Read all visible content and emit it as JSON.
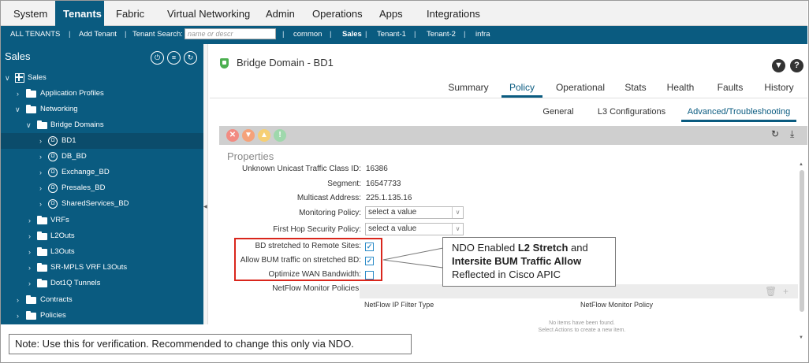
{
  "top_nav": {
    "tabs": [
      {
        "label": "System",
        "active": false
      },
      {
        "label": "Tenants",
        "active": true
      },
      {
        "label": "Fabric",
        "active": false
      },
      {
        "label": "Virtual Networking",
        "active": false
      },
      {
        "label": "Admin",
        "active": false
      },
      {
        "label": "Operations",
        "active": false
      },
      {
        "label": "Apps",
        "active": false
      },
      {
        "label": "Integrations",
        "active": false
      }
    ]
  },
  "sub_nav": {
    "all_tenants": "ALL TENANTS",
    "sep": "|",
    "add_tenant": "Add Tenant",
    "tenant_search_label": "Tenant Search:",
    "search_placeholder": "name or descr",
    "tenants": [
      "common",
      "Sales",
      "Tenant-1",
      "Tenant-2",
      "infra"
    ],
    "active_tenant": "Sales"
  },
  "sidebar": {
    "title": "Sales",
    "header_icons": [
      "quick-start-icon",
      "list-icon",
      "refresh-icon"
    ],
    "tree": [
      {
        "label": "Sales",
        "level": 0,
        "icon": "tenant-icon",
        "expanded": true
      },
      {
        "label": "Application Profiles",
        "level": 1,
        "icon": "folder-icon",
        "expanded": false
      },
      {
        "label": "Networking",
        "level": 1,
        "icon": "folder-icon",
        "expanded": true
      },
      {
        "label": "Bridge Domains",
        "level": 2,
        "icon": "folder-icon",
        "expanded": true
      },
      {
        "label": "BD1",
        "level": 3,
        "icon": "bridge-domain-icon",
        "expanded": false,
        "selected": true
      },
      {
        "label": "DB_BD",
        "level": 3,
        "icon": "bridge-domain-icon",
        "expanded": false
      },
      {
        "label": "Exchange_BD",
        "level": 3,
        "icon": "bridge-domain-icon",
        "expanded": false
      },
      {
        "label": "Presales_BD",
        "level": 3,
        "icon": "bridge-domain-icon",
        "expanded": false
      },
      {
        "label": "SharedServices_BD",
        "level": 3,
        "icon": "bridge-domain-icon",
        "expanded": false
      },
      {
        "label": "VRFs",
        "level": 2,
        "icon": "folder-icon",
        "expanded": false
      },
      {
        "label": "L2Outs",
        "level": 2,
        "icon": "folder-icon",
        "expanded": false
      },
      {
        "label": "L3Outs",
        "level": 2,
        "icon": "folder-icon",
        "expanded": false
      },
      {
        "label": "SR-MPLS VRF L3Outs",
        "level": 2,
        "icon": "folder-icon",
        "expanded": false
      },
      {
        "label": "Dot1Q Tunnels",
        "level": 2,
        "icon": "folder-icon",
        "expanded": false
      },
      {
        "label": "Contracts",
        "level": 1,
        "icon": "folder-icon",
        "expanded": false
      },
      {
        "label": "Policies",
        "level": 1,
        "icon": "folder-icon",
        "expanded": false
      }
    ]
  },
  "main": {
    "title": "Bridge Domain - BD1",
    "tabs": [
      {
        "label": "Summary",
        "active": false
      },
      {
        "label": "Policy",
        "active": true
      },
      {
        "label": "Operational",
        "active": false
      },
      {
        "label": "Stats",
        "active": false
      },
      {
        "label": "Health",
        "active": false
      },
      {
        "label": "Faults",
        "active": false
      },
      {
        "label": "History",
        "active": false
      }
    ],
    "subtabs": [
      {
        "label": "General",
        "active": false
      },
      {
        "label": "L3 Configurations",
        "active": false
      },
      {
        "label": "Advanced/Troubleshooting",
        "active": true
      }
    ],
    "toolbar_icons": [
      "critical-fault-icon",
      "major-fault-icon",
      "minor-fault-icon",
      "warning-fault-icon"
    ],
    "section_title": "Properties",
    "properties": {
      "unknown_unicast_label": "Unknown Unicast Traffic Class ID:",
      "unknown_unicast_value": "16386",
      "segment_label": "Segment:",
      "segment_value": "16547733",
      "multicast_label": "Multicast Address:",
      "multicast_value": "225.1.135.16",
      "monitoring_policy_label": "Monitoring Policy:",
      "monitoring_policy_value": "select a value",
      "first_hop_label": "First Hop Security Policy:",
      "first_hop_value": "select a value",
      "bd_stretched_label": "BD stretched to Remote Sites:",
      "bd_stretched_checked": true,
      "allow_bum_label": "Allow BUM traffic on stretched BD:",
      "allow_bum_checked": true,
      "optimize_wan_label": "Optimize WAN Bandwidth:",
      "optimize_wan_checked": false,
      "netflow_label": "NetFlow Monitor Policies:"
    },
    "netflow_table": {
      "columns": [
        "NetFlow IP Filter Type",
        "NetFlow Monitor Policy"
      ],
      "empty_line1": "No items have been found.",
      "empty_line2": "Select Actions to create a new item."
    }
  },
  "callout": {
    "line1_prefix": "NDO Enabled ",
    "line1_bold": "L2 Stretch",
    "line1_suffix": " and",
    "line2_bold": "Intersite BUM Traffic Allow",
    "line3": "Reflected in Cisco APIC"
  },
  "note": "Note: Use this for verification. Recommended to change this only via NDO.",
  "colors": {
    "brand_blue": "#0a5b80",
    "highlight_red": "#d9261c",
    "checkbox_blue": "#2a8ac7"
  }
}
